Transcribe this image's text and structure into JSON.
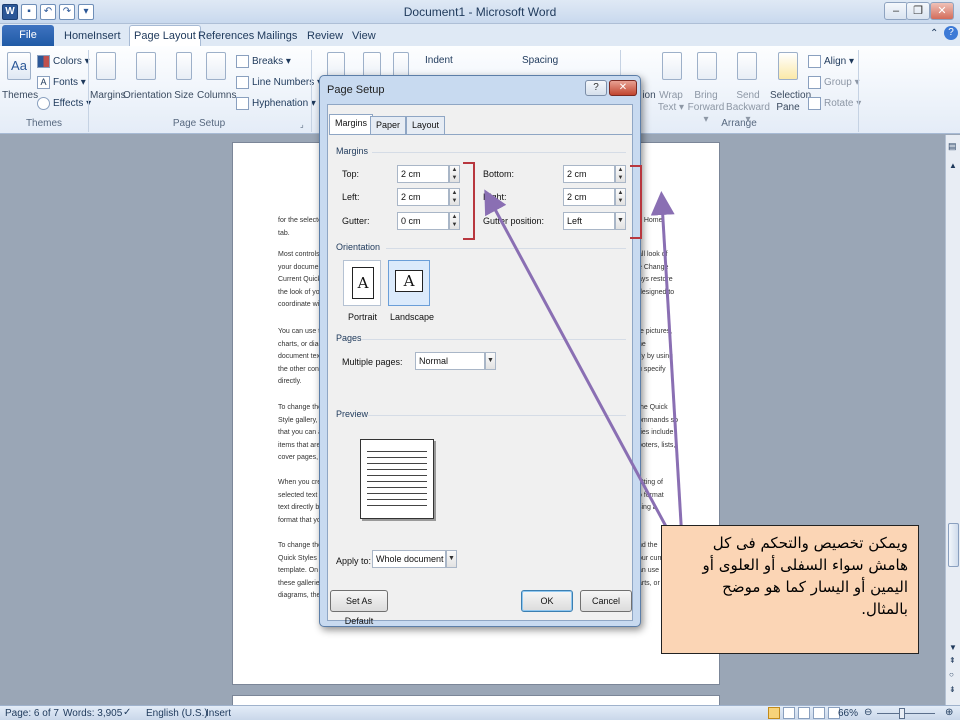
{
  "window": {
    "title": "Document1 - Microsoft Word"
  },
  "tabs": [
    "File",
    "Home",
    "Insert",
    "Page Layout",
    "References",
    "Mailings",
    "Review",
    "View"
  ],
  "ribbon": {
    "themes": {
      "big": "Themes",
      "colors": "Colors ▾",
      "fonts": "Fonts ▾",
      "effects": "Effects ▾",
      "group": "Themes"
    },
    "page_setup": {
      "margins": "Margins",
      "orientation": "Orientation",
      "size": "Size",
      "columns": "Columns",
      "breaks": "Breaks ▾",
      "line_numbers": "Line Numbers ▾",
      "hyphenation": "Hyphenation ▾",
      "group": "Page Setup"
    },
    "paragraph": {
      "indent": "Indent",
      "spacing": "Spacing"
    },
    "arrange": {
      "position": "ion",
      "wrap_text": "Wrap Text ▾",
      "bring_forward": "Bring Forward ▾",
      "send_backward": "Send Backward ▾",
      "selection_pane": "Selection Pane",
      "align": "Align ▾",
      "group_btn": "Group ▾",
      "rotate": "Rotate ▾",
      "group": "Arrange"
    }
  },
  "document": {
    "paragraphs": [
      {
        "left": "for the selected",
        "left2": "tab.",
        "right": "e Home"
      },
      {
        "left": "Most controls o",
        "left2": "your document",
        "left3": "Current Quick S",
        "left4": "the look of you",
        "left5": "coordinate with",
        "right": "all look of",
        "right2": "e Change",
        "right3": "ays restore",
        "right4": "designed to"
      },
      {
        "left": "You can use the",
        "left2": "charts, or diag",
        "left3": "document text",
        "left4": "the other contr",
        "left5": "directly.",
        "right": "te pictures,",
        "right2": "he",
        "right3": "tly by using",
        "right4": "u specify"
      },
      {
        "left": "To change the",
        "left2": "Style gallery, u",
        "left3": "that you can al",
        "left4": "items that are",
        "left5": "cover pages, a",
        "right": "the Quick",
        "right2": "ommands so",
        "right3": "ries include",
        "right4": "ooters, lists,"
      },
      {
        "left": "When you crea",
        "left2": "selected text in",
        "left3": "text directly by",
        "left4": "format that yo",
        "right": "atting of",
        "right2": "o format",
        "right3": "sing a"
      },
      {
        "left": "To change the",
        "left2": "Quick Styles ga",
        "left3": "template. On th",
        "left4": "these galleries",
        "left5": "diagrams, they",
        "right": "nd the",
        "right2": "our current",
        "right3": "an use",
        "right4": "arts, or"
      }
    ]
  },
  "dialog": {
    "title": "Page Setup",
    "tabs": [
      "Margins",
      "Paper",
      "Layout"
    ],
    "margins_section": "Margins",
    "top_label": "Top:",
    "top_value": "2 cm",
    "bottom_label": "Bottom:",
    "bottom_value": "2 cm",
    "left_label": "Left:",
    "left_value": "2 cm",
    "right_label": "Right:",
    "right_value": "2 cm",
    "gutter_label": "Gutter:",
    "gutter_value": "0 cm",
    "gutter_position_label": "Gutter position:",
    "gutter_position_value": "Left",
    "orientation_section": "Orientation",
    "portrait": "Portrait",
    "landscape": "Landscape",
    "pages_section": "Pages",
    "multiple_pages_label": "Multiple pages:",
    "multiple_pages_value": "Normal",
    "preview_section": "Preview",
    "apply_to_label": "Apply to:",
    "apply_to_value": "Whole document",
    "set_default": "Set As Default",
    "ok": "OK",
    "cancel": "Cancel",
    "help": "?",
    "close": "✕"
  },
  "note": {
    "text": "ويمكن تخصيص والتحكم فى كل هامش سواء السفلى أو العلوى أو اليمين أو اليسار كما هو موضح بالمثال."
  },
  "status": {
    "page": "Page: 6 of 7",
    "words": "Words: 3,905",
    "language": "English (U.S.)",
    "mode": "Insert",
    "zoom": "66%"
  },
  "colors": {
    "accent": "#2b5797",
    "annotation_bracket": "#b8373e",
    "annotation_arrow": "#8a6fb3",
    "note_bg": "#fbd5b5"
  }
}
